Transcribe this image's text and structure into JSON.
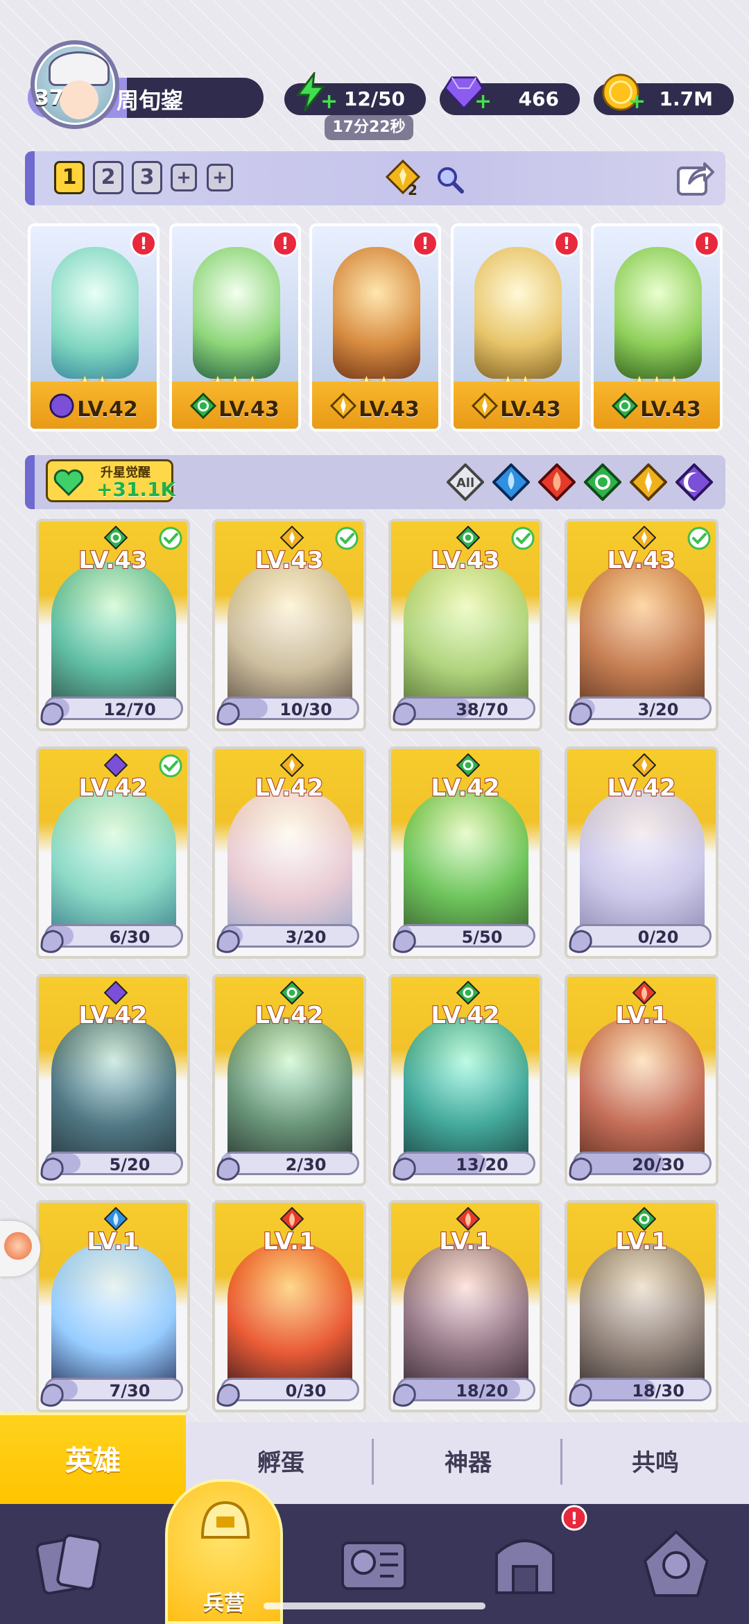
{
  "player": {
    "level": "37",
    "name": "周旬鋆"
  },
  "resources": {
    "energy": "12/50",
    "energy_timer": "17分22秒",
    "gems": "466",
    "gold": "1.7M"
  },
  "team_bar": {
    "slots": [
      "1",
      "2",
      "3",
      "+",
      "+"
    ],
    "active_slot": "1",
    "badge_count": "2"
  },
  "team": [
    {
      "level": "LV.42",
      "element": "dark",
      "stars": "★★"
    },
    {
      "level": "LV.43",
      "element": "wind",
      "stars": "★★★"
    },
    {
      "level": "LV.43",
      "element": "light",
      "stars": "★★"
    },
    {
      "level": "LV.43",
      "element": "light",
      "stars": "★★"
    },
    {
      "level": "LV.43",
      "element": "wind",
      "stars": "★★★"
    }
  ],
  "awaken": {
    "label": "升星觉醒",
    "value": "+31.1K"
  },
  "filters": [
    "All",
    "water",
    "fire",
    "wind",
    "light",
    "dark"
  ],
  "heroes": [
    {
      "level": "LV.43",
      "element": "wind",
      "progress": "12/70",
      "ready": true
    },
    {
      "level": "LV.43",
      "element": "light",
      "progress": "10/30",
      "ready": true
    },
    {
      "level": "LV.43",
      "element": "wind",
      "progress": "38/70",
      "ready": true
    },
    {
      "level": "LV.43",
      "element": "light",
      "progress": "3/20",
      "ready": true
    },
    {
      "level": "LV.42",
      "element": "dark",
      "progress": "6/30",
      "ready": true
    },
    {
      "level": "LV.42",
      "element": "light",
      "progress": "3/20",
      "ready": false
    },
    {
      "level": "LV.42",
      "element": "wind",
      "progress": "5/50",
      "ready": false
    },
    {
      "level": "LV.42",
      "element": "light",
      "progress": "0/20",
      "ready": false
    },
    {
      "level": "LV.42",
      "element": "dark",
      "progress": "5/20",
      "ready": false
    },
    {
      "level": "LV.42",
      "element": "wind",
      "progress": "2/30",
      "ready": false
    },
    {
      "level": "LV.42",
      "element": "wind",
      "progress": "13/20",
      "ready": false
    },
    {
      "level": "LV.1",
      "element": "fire",
      "progress": "20/30",
      "ready": false
    },
    {
      "level": "LV.1",
      "element": "water",
      "progress": "7/30",
      "ready": false
    },
    {
      "level": "LV.1",
      "element": "fire",
      "progress": "0/30",
      "ready": false
    },
    {
      "level": "LV.1",
      "element": "fire",
      "progress": "18/20",
      "ready": false
    },
    {
      "level": "LV.1",
      "element": "wind",
      "progress": "18/30",
      "ready": false
    }
  ],
  "tabs": [
    "英雄",
    "孵蛋",
    "神器",
    "共鸣"
  ],
  "nav": {
    "barracks_label": "兵营"
  },
  "colors": {
    "wind": "#2fb24a",
    "light": "#f0b01c",
    "dark": "#7b4fd8",
    "fire": "#e53a2a",
    "water": "#2f8fe0"
  }
}
